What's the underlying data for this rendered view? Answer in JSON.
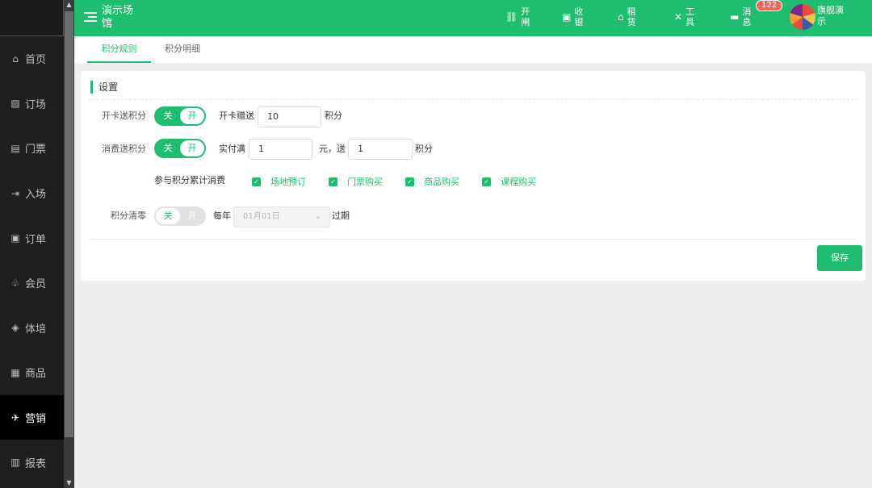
{
  "sidebar": {
    "items": [
      {
        "icon": "home-icon",
        "glyph": "⌂",
        "label": "首页"
      },
      {
        "icon": "court-booking-icon",
        "glyph": "▨",
        "label": "订场"
      },
      {
        "icon": "ticket-icon",
        "glyph": "▤",
        "label": "门票"
      },
      {
        "icon": "entry-icon",
        "glyph": "⇥",
        "label": "入场"
      },
      {
        "icon": "order-icon",
        "glyph": "▣",
        "label": "订单"
      },
      {
        "icon": "member-icon",
        "glyph": "♧",
        "label": "会员"
      },
      {
        "icon": "training-icon",
        "glyph": "◈",
        "label": "体培"
      },
      {
        "icon": "goods-icon",
        "glyph": "▦",
        "label": "商品"
      },
      {
        "icon": "marketing-icon",
        "glyph": "✈",
        "label": "营销",
        "active": true
      },
      {
        "icon": "report-icon",
        "glyph": "▥",
        "label": "报表"
      }
    ]
  },
  "header": {
    "venue_name": "演示场馆",
    "tools": [
      {
        "icon": "gate-icon",
        "glyph": "⛓",
        "label": "开闸"
      },
      {
        "icon": "cashier-icon",
        "glyph": "▣",
        "label": "收银"
      },
      {
        "icon": "rent-icon",
        "glyph": "⌂",
        "label": "租赁"
      },
      {
        "icon": "tools-icon",
        "glyph": "✕",
        "label": "工具"
      },
      {
        "icon": "message-icon",
        "glyph": "▬",
        "label": "消息"
      }
    ],
    "message_count": "122",
    "user_name": "旗舰演示"
  },
  "tabs": [
    {
      "label": "积分规则",
      "active": true
    },
    {
      "label": "积分明细",
      "active": false
    }
  ],
  "settings": {
    "title": "设置",
    "card_points": {
      "label": "开卡送积分",
      "toggle_off": "关",
      "toggle_on": "开",
      "enabled": true,
      "prefix": "开卡赠送",
      "value": "10",
      "unit": "积分"
    },
    "spend_points": {
      "label": "消费送积分",
      "toggle_off": "关",
      "toggle_on": "开",
      "enabled": true,
      "prefix": "实付满",
      "spend_value": "1",
      "middle": "元，送",
      "points_value": "1",
      "unit": "积分"
    },
    "accumulate": {
      "label": "参与积分累计消费",
      "options": [
        {
          "label": "场地预订",
          "checked": true
        },
        {
          "label": "门票购买",
          "checked": true
        },
        {
          "label": "商品购买",
          "checked": true
        },
        {
          "label": "课程购买",
          "checked": true
        }
      ]
    },
    "clear_points": {
      "label": "积分清零",
      "toggle_off": "关",
      "toggle_on": "开",
      "enabled": false,
      "prefix": "每年",
      "date_value": "01月01日",
      "suffix": "过期"
    },
    "save_label": "保存"
  },
  "colors": {
    "brand": "#1fbe6e",
    "sidebar_bg": "#1f1f1f",
    "badge": "#f5655a"
  }
}
